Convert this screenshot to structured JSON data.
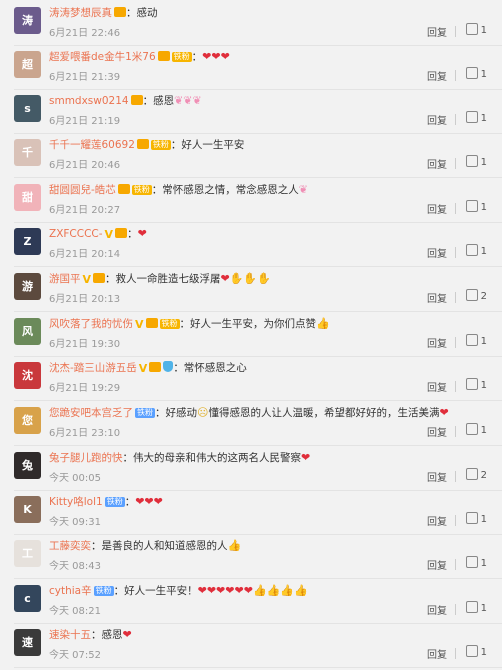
{
  "comments": [
    {
      "user": "涛涛梦想辰真",
      "vip_crown": true,
      "text": "：感动",
      "time": "6月21日 22:46",
      "likes": "1",
      "avatar_color": "#6b5b8c",
      "avatar_initial": "涛"
    },
    {
      "user": "超爱喂番de金牛1米76",
      "vip_crown": true,
      "badge": "铁粉",
      "badge_type": "fan",
      "text": "：",
      "emoji": "❤❤❤",
      "emoji_type": "heart",
      "time": "6月21日 21:39",
      "likes": "1",
      "avatar_color": "#caa58e",
      "avatar_initial": "超"
    },
    {
      "user": "smmdxsw0214",
      "vip_crown": true,
      "text": "：感恩",
      "emoji": "❦❦❦",
      "emoji_type": "pink",
      "time": "6月21日 21:19",
      "likes": "1",
      "avatar_color": "#445a66",
      "avatar_initial": "s"
    },
    {
      "user": "千千一耀莲60692",
      "vip_crown": true,
      "badge": "铁粉",
      "badge_type": "fan",
      "text": "：好人一生平安",
      "time": "6月21日 20:46",
      "likes": "1",
      "avatar_color": "#d9c2b8",
      "avatar_initial": "千"
    },
    {
      "user": "甜圆圆兒-皓芯",
      "vip_crown": true,
      "badge": "铁粉",
      "badge_type": "fan",
      "text": "：常怀感恩之情，常念感恩之人",
      "emoji": "❦",
      "emoji_type": "pink",
      "time": "6月21日 20:27",
      "likes": "1",
      "avatar_color": "#f1b3b9",
      "avatar_initial": "甜"
    },
    {
      "user": "ZXFCCCC-",
      "vip": "V",
      "vip_crown": true,
      "text": "：",
      "emoji": "❤",
      "emoji_type": "heart",
      "time": "6月21日 20:14",
      "likes": "1",
      "avatar_color": "#2e3a56",
      "avatar_initial": "Z"
    },
    {
      "user": "游国平",
      "vip": "V",
      "vip_crown": true,
      "text": "：救人一命胜造七级浮屠",
      "emoji": "❤✋✋✋",
      "emoji_type": "heart",
      "time": "6月21日 20:13",
      "likes": "2",
      "avatar_color": "#5c4a3e",
      "avatar_initial": "游"
    },
    {
      "user": "风吹落了我的忧伤",
      "vip": "V",
      "vip_crown": true,
      "badge": "铁粉",
      "badge_type": "fan",
      "text": "：好人一生平安，为你们点赞",
      "emoji": "👍",
      "emoji_type": "gold",
      "time": "6月21日 19:30",
      "likes": "1",
      "avatar_color": "#6b8a5a",
      "avatar_initial": "风"
    },
    {
      "user": "沈杰-踏三山游五岳",
      "vip": "V",
      "vip_crown": true,
      "shield": true,
      "text": "：常怀感恩之心",
      "time": "6月21日 19:29",
      "likes": "1",
      "avatar_color": "#c9383c",
      "avatar_initial": "沈"
    },
    {
      "user": "您跪安吧本宫乏了",
      "badge": "铁粉",
      "badge_type": "iron",
      "text": "：好感动",
      "text2": "懂得感恩的人让人温暖，希望都好好的，生活美满",
      "emoji_mid": "☹",
      "emoji": "❤",
      "emoji_type": "heart",
      "time": "6月21日 23:10",
      "likes": "1",
      "avatar_color": "#d8a24a",
      "avatar_initial": "您"
    },
    {
      "user": "兔子腿儿跑的快",
      "text": "：伟大的母亲和伟大的这两名人民警察",
      "emoji": "❤",
      "emoji_type": "heart",
      "time": "今天 00:05",
      "likes": "2",
      "avatar_color": "#2f2a2a",
      "avatar_initial": "兔"
    },
    {
      "user": "Kitty咯lol1",
      "badge": "铁粉",
      "badge_type": "iron",
      "text": "：",
      "emoji": "❤❤❤",
      "emoji_type": "heart",
      "time": "今天 09:31",
      "likes": "1",
      "avatar_color": "#8a6e5b",
      "avatar_initial": "K"
    },
    {
      "user": "工藤奕奕",
      "text": "：是善良的人和知道感恩的人",
      "emoji": "👍",
      "emoji_type": "gold",
      "time": "今天 08:43",
      "likes": "1",
      "avatar_color": "#e6e1dc",
      "avatar_initial": "工"
    },
    {
      "user": "cythia辛",
      "badge": "铁粉",
      "badge_type": "iron",
      "text": "：好人一生平安！",
      "emoji": "❤❤❤❤❤❤",
      "emoji2": "👍👍👍👍",
      "emoji_type": "heart",
      "time": "今天 08:21",
      "likes": "1",
      "avatar_color": "#33465c",
      "avatar_initial": "c"
    },
    {
      "user": "速染十五",
      "text": "：感恩",
      "emoji": "❤",
      "emoji_type": "heart",
      "time": "今天 07:52",
      "likes": "1",
      "avatar_color": "#3a3a3a",
      "avatar_initial": "速"
    }
  ],
  "reply_label": "回复"
}
